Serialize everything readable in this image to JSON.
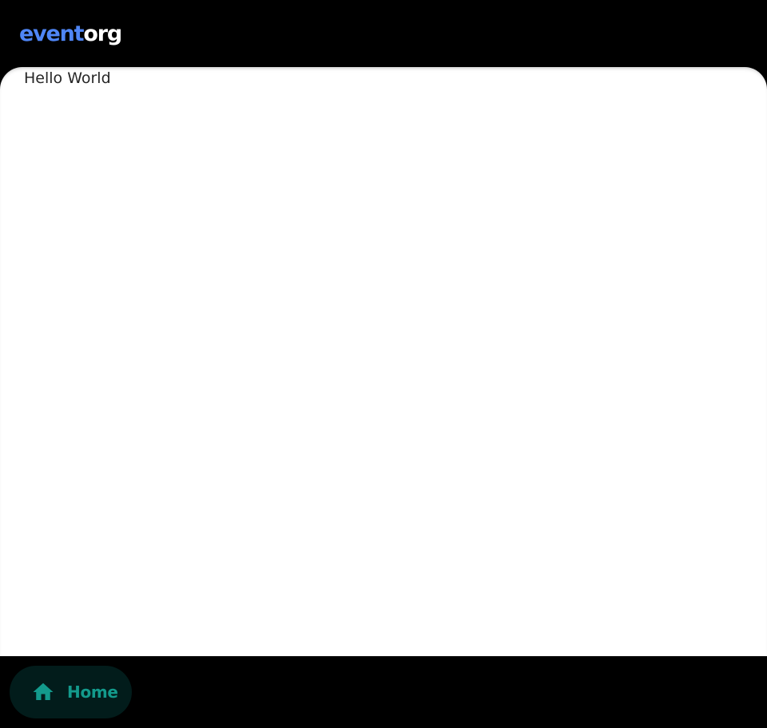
{
  "app": {
    "logo_part1": "event",
    "logo_part2": "org"
  },
  "colors": {
    "logo_accent": "#4f86f7",
    "logo_text": "#ffffff",
    "nav_active": "#139a8c",
    "nav_active_bg": "#021c1b",
    "background": "#000000",
    "content_bg": "#ffffff"
  },
  "main": {
    "text": "Hello World"
  },
  "bottom_nav": {
    "items": [
      {
        "label": "Home",
        "icon": "home-icon",
        "active": true
      }
    ]
  }
}
